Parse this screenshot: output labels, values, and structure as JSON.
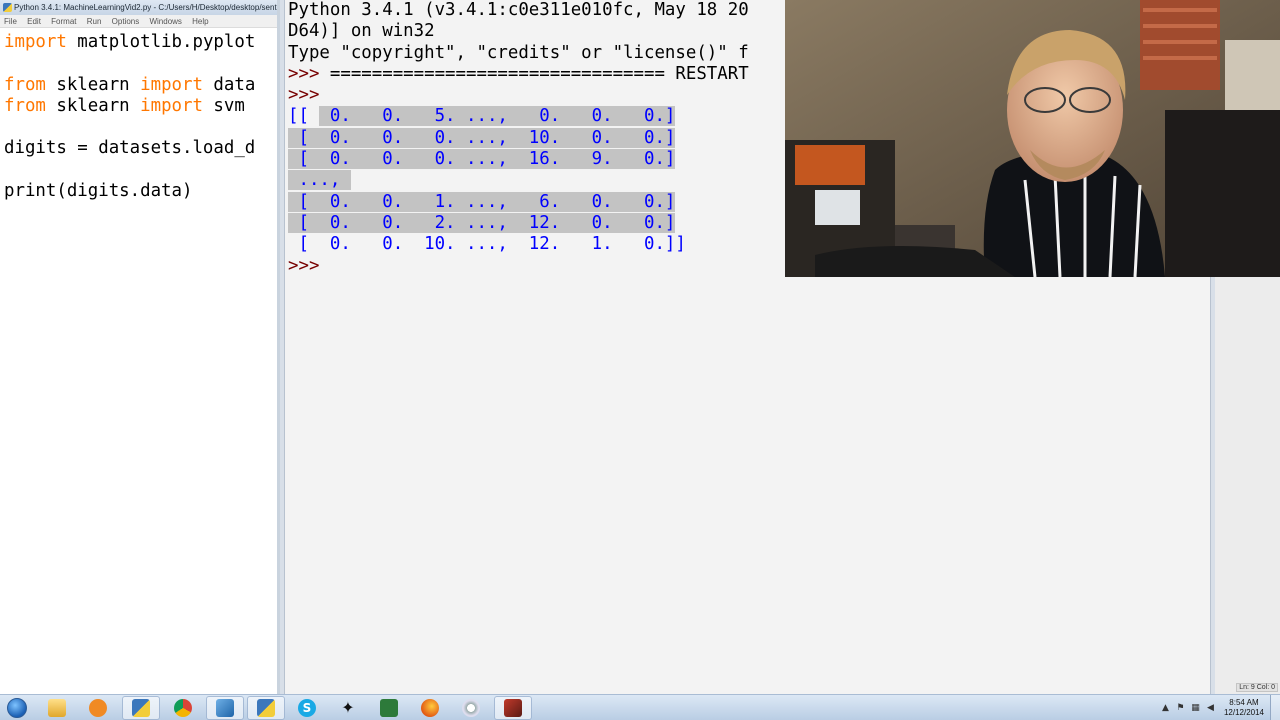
{
  "editor": {
    "title": "Python 3.4.1: MachineLearningVid2.py - C:/Users/H/Desktop/desktop/sent",
    "menu": [
      "File",
      "Edit",
      "Format",
      "Run",
      "Options",
      "Windows",
      "Help"
    ],
    "lines": [
      [
        {
          "t": "import",
          "k": true
        },
        {
          "t": " matplotlib.pyplot"
        }
      ],
      [],
      [
        {
          "t": "from",
          "k": true
        },
        {
          "t": " sklearn "
        },
        {
          "t": "import",
          "k": true
        },
        {
          "t": " data"
        }
      ],
      [
        {
          "t": "from",
          "k": true
        },
        {
          "t": " sklearn "
        },
        {
          "t": "import",
          "k": true
        },
        {
          "t": " svm"
        }
      ],
      [],
      [
        {
          "t": "digits = datasets.load_d"
        }
      ],
      [],
      [
        {
          "t": "print(digits.data)"
        }
      ]
    ]
  },
  "shell": {
    "lines": [
      {
        "text": "Python 3.4.1 (v3.4.1:c0e311e010fc, May 18 20"
      },
      {
        "text": "D64)] on win32"
      },
      {
        "text": "Type \"copyright\", \"credits\" or \"license()\" f"
      },
      {
        "prompt": ">>> ",
        "text": "================================ RESTART"
      },
      {
        "prompt": ">>> ",
        "text": ""
      },
      {
        "out": "[[ ",
        "sel": " 0.   0.   5. ...,   0.   0.   0.]"
      },
      {
        "sel": " [  0.   0.   0. ...,  10.   0.   0.]"
      },
      {
        "sel": " [  0.   0.   0. ...,  16.   9.   0.]"
      },
      {
        "sel": " ..., "
      },
      {
        "sel": " [  0.   0.   1. ...,   6.   0.   0.]"
      },
      {
        "sel": " [  0.   0.   2. ...,  12.   0.   0.]"
      },
      {
        "out": " [  0.   0.  10. ...,  12.   1.   0.]]"
      },
      {
        "prompt": ">>> ",
        "text": ""
      }
    ]
  },
  "status_bar": "Ln: 9 Col: 0",
  "taskbar": {
    "apps": [
      "start-orb",
      "explorer",
      "media-player",
      "idle-python",
      "chrome",
      "notepad",
      "python-shell",
      "skype",
      "corsair-app",
      "green-app",
      "firefox",
      "webcam-app",
      "zbrush-app"
    ],
    "clock_time": "8:54 AM",
    "clock_date": "12/12/2014"
  },
  "colors": {
    "keyword": "#ff7700",
    "prompt": "#770000",
    "output": "#0000ff",
    "selection": "#c3c3c3"
  }
}
